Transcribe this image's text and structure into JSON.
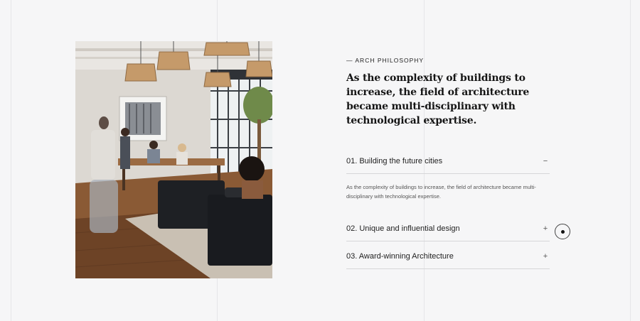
{
  "section": {
    "eyebrow": "— ARCH PHILOSOPHY",
    "heading": "As the complexity of buildings to increase, the field of architecture became multi-disciplinary with technological expertise."
  },
  "accordion": {
    "items": [
      {
        "title": "01. Building the future cities",
        "toggle": "−",
        "body": "As the complexity of buildings to increase, the field of architecture became multi-disciplinary with technological expertise."
      },
      {
        "title": "02. Unique and influential design",
        "toggle": "+"
      },
      {
        "title": "03. Award-winning Architecture",
        "toggle": "+"
      }
    ]
  },
  "icons": {
    "circle_button": "circle-dot-icon",
    "photo": "office-photo"
  }
}
